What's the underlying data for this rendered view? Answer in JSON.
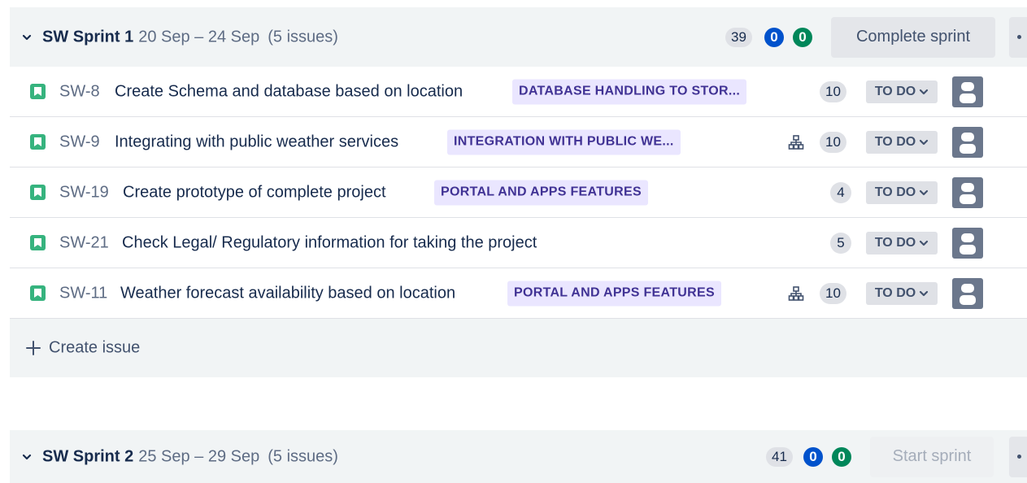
{
  "sprints": [
    {
      "name": "SW Sprint 1",
      "dates": "20 Sep – 24 Sep",
      "issue_count": "(5 issues)",
      "points_todo": "39",
      "points_in_progress": "0",
      "points_done": "0",
      "action_label": "Complete sprint"
    },
    {
      "name": "SW Sprint 2",
      "dates": "25 Sep – 29 Sep",
      "issue_count": "(5 issues)",
      "points_todo": "41",
      "points_in_progress": "0",
      "points_done": "0",
      "action_label": "Start sprint"
    }
  ],
  "issues": [
    {
      "key": "SW-8",
      "summary": "Create Schema and database based on location",
      "epic": "DATABASE HANDLING TO STOR...",
      "has_children": false,
      "points": "10",
      "status": "TO DO"
    },
    {
      "key": "SW-9",
      "summary": "Integrating with public weather services",
      "epic": "INTEGRATION WITH PUBLIC WE...",
      "has_children": true,
      "points": "10",
      "status": "TO DO"
    },
    {
      "key": "SW-19",
      "summary": "Create prototype of complete project",
      "epic": "PORTAL AND APPS FEATURES",
      "has_children": false,
      "points": "4",
      "status": "TO DO"
    },
    {
      "key": "SW-21",
      "summary": "Check Legal/ Regulatory information for taking the project",
      "epic": "",
      "has_children": false,
      "points": "5",
      "status": "TO DO"
    },
    {
      "key": "SW-11",
      "summary": "Weather forecast availability based on location",
      "epic": "PORTAL AND APPS FEATURES",
      "has_children": true,
      "points": "10",
      "status": "TO DO"
    }
  ],
  "create_issue_label": "Create issue",
  "icons": {
    "collapse": "chevron-down-icon",
    "story": "story-icon",
    "child_issues": "child-issues-icon",
    "status_dropdown": "chevron-down-icon",
    "assignee": "avatar-placeholder-icon",
    "create": "plus-icon",
    "more": "more-icon"
  },
  "colors": {
    "story": "#36b37e",
    "epic_bg": "#eae6ff",
    "epic_text": "#403294",
    "in_progress": "#0052cc",
    "done": "#00875a",
    "header_bg": "#f1f4f5"
  }
}
